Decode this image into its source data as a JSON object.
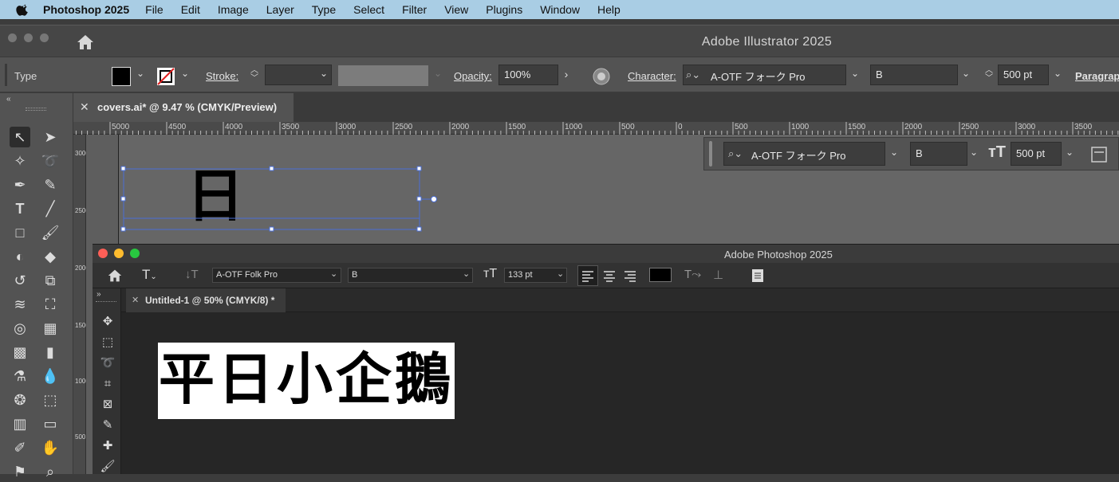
{
  "menubar": {
    "app": "Photoshop 2025",
    "items": [
      "File",
      "Edit",
      "Image",
      "Layer",
      "Type",
      "Select",
      "Filter",
      "View",
      "Plugins",
      "Window",
      "Help"
    ]
  },
  "illustrator": {
    "title": "Adobe Illustrator 2025",
    "control_bar": {
      "mode_label": "Type",
      "stroke_label": "Stroke:",
      "opacity_label": "Opacity:",
      "opacity_value": "100%",
      "character_label": "Character:",
      "font_family": "A-OTF フォーク Pro",
      "font_style": "B",
      "font_size": "500 pt",
      "paragraph_label": "Paragraph"
    },
    "tab_title": "covers.ai* @ 9.47 % (CMYK/Preview)",
    "ruler_ticks": [
      "5000",
      "4500",
      "4000",
      "3500",
      "3000",
      "2500",
      "2000",
      "1500",
      "1000",
      "500",
      "0",
      "500",
      "1000",
      "1500",
      "2000",
      "2500",
      "3000",
      "3500"
    ],
    "canvas_glyph": "日",
    "floating_panel": {
      "font_family": "A-OTF フォーク Pro",
      "font_style": "B",
      "font_size": "500 pt"
    },
    "vruler_labels": [
      "3000",
      "2500",
      "2000",
      "1500",
      "1000",
      "500"
    ]
  },
  "photoshop": {
    "title": "Adobe Photoshop 2025",
    "options_bar": {
      "font_family": "A-OTF Folk Pro",
      "font_style": "B",
      "font_size": "133 pt"
    },
    "tab_title": "Untitled-1 @ 50% (CMYK/8) *",
    "doc_text": "平日小企鵝"
  },
  "colors": {
    "menubar": "#a9cde4",
    "ai_panel": "#535353",
    "ps_canvas": "#262626",
    "selection": "#4b6fd6"
  }
}
